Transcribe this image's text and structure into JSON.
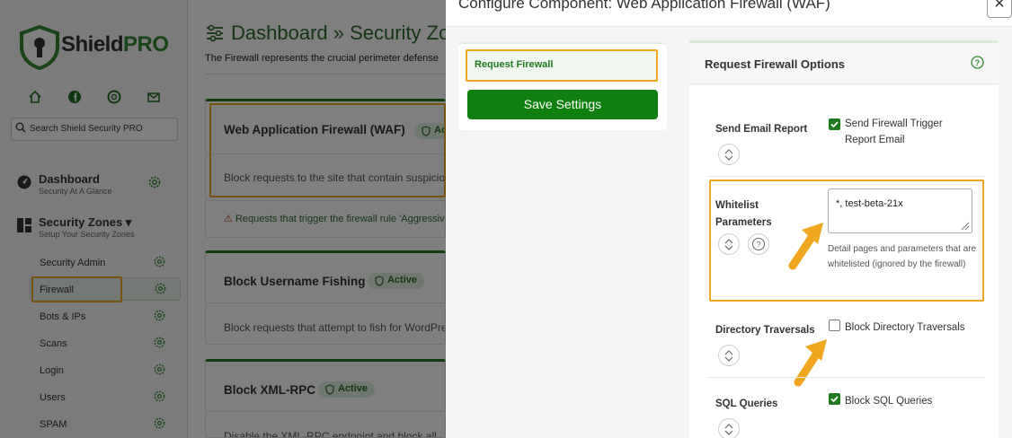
{
  "brand": {
    "name_main": "Shield",
    "name_pro": "PRO"
  },
  "search": {
    "placeholder": "Search Shield Security PRO"
  },
  "nav": {
    "dashboard": {
      "title": "Dashboard",
      "subtitle": "Security At A Glance"
    },
    "zones": {
      "title": "Security Zones ▾",
      "subtitle": "Setup Your Security Zones"
    },
    "items": [
      "Security Admin",
      "Firewall",
      "Bots & IPs",
      "Scans",
      "Login",
      "Users",
      "SPAM"
    ]
  },
  "page": {
    "title": "Dashboard » Security Zones",
    "description": "The Firewall represents the crucial perimeter defense"
  },
  "cards": [
    {
      "title": "Web Application Firewall (WAF)",
      "badge": "Active",
      "desc": "Block requests to the site that contain suspicious",
      "warn": "Requests that trigger the firewall rule 'Aggressive'"
    },
    {
      "title": "Block Username Fishing",
      "badge": "Active",
      "desc": "Block requests that attempt to fish for WordPress"
    },
    {
      "title": "Block XML-RPC",
      "badge": "Active",
      "desc": "Disable the XML-RPC endpoint and block all"
    }
  ],
  "modal": {
    "title": "Configure Component: Web Application Firewall (WAF)",
    "close": "×",
    "tab": "Request Firewall",
    "save": "Save Settings",
    "options_title": "Request Firewall Options",
    "options": {
      "email": {
        "label": "Send Email Report",
        "check": "Send Firewall Trigger Report Email",
        "checked": true
      },
      "whitelist": {
        "label": "Whitelist Parameters",
        "value": "*, test-beta-21x",
        "help": "Detail pages and parameters that are whitelisted (ignored by the firewall)"
      },
      "dir": {
        "label": "Directory Traversals",
        "check": "Block Directory Traversals",
        "checked": false
      },
      "sql": {
        "label": "SQL Queries",
        "check": "Block SQL Queries",
        "checked": true
      }
    }
  },
  "colors": {
    "accent": "#1f7a1f",
    "highlight": "#f0a61e",
    "button": "#0f800f"
  }
}
